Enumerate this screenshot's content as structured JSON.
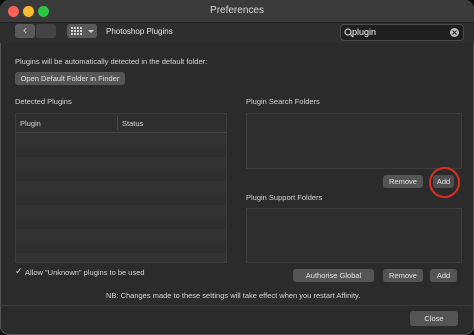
{
  "window": {
    "title": "Preferences"
  },
  "toolbar": {
    "back_glyph": "‹",
    "section": "Photoshop Plugins",
    "search_value": "plugin"
  },
  "main": {
    "info": "Plugins will be automatically detected in the default folder:",
    "open_default_btn": "Open Default Folder in Finder",
    "detected_title": "Detected Plugins",
    "columns": [
      "Plugin",
      "Status"
    ],
    "search_folders_title": "Plugin Search Folders",
    "search_remove": "Remove",
    "search_add": "Add",
    "support_folders_title": "Plugin Support Folders",
    "support_authorise": "Authorise Global",
    "support_remove": "Remove",
    "support_add": "Add",
    "checkbox_label": "Allow \"Unknown\" plugins to be used",
    "note": "NB: Changes made to these settings will take effect when you restart Affinity."
  },
  "footer": {
    "close": "Close"
  },
  "colors": {
    "highlight": "#e02b20",
    "window_bg": "#2b2b2b",
    "button_bg": "#555555"
  },
  "icons": [
    "back-icon",
    "forward-icon",
    "grid-icon",
    "dropdown-arrow-icon",
    "search-icon",
    "clear-search-icon",
    "checkmark-icon"
  ]
}
